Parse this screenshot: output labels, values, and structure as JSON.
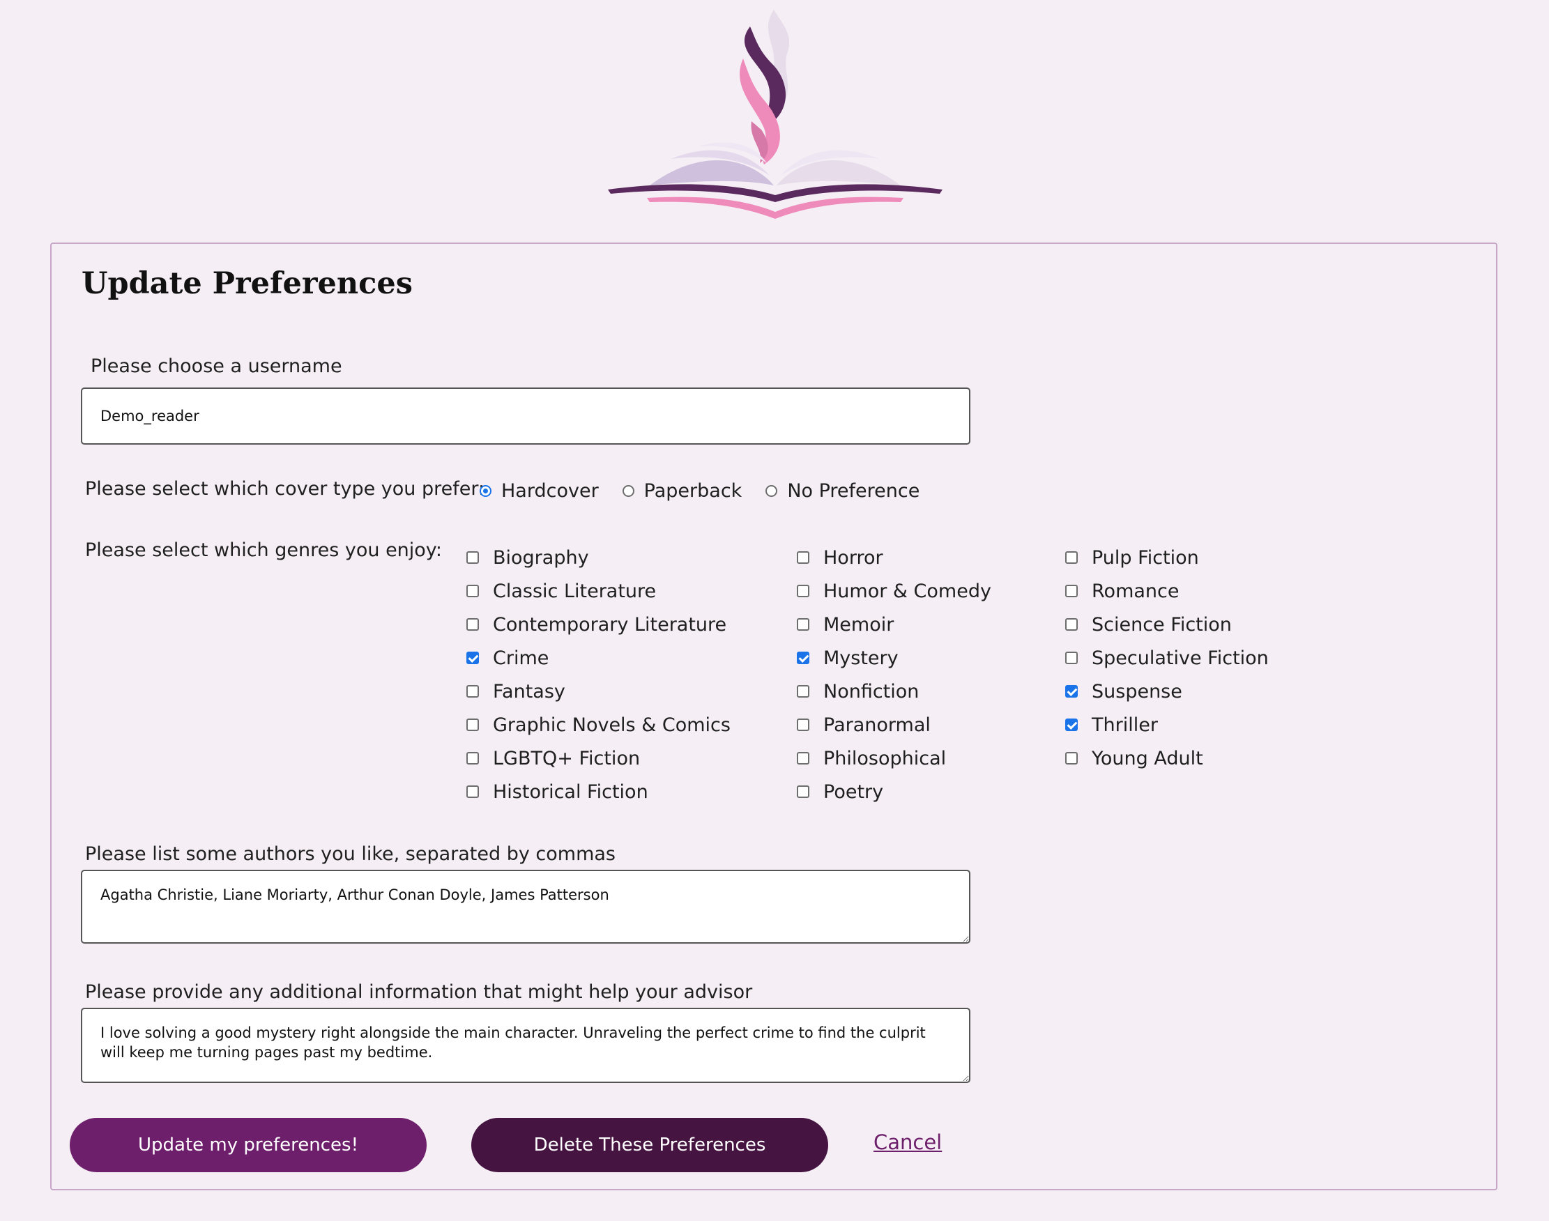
{
  "logo": {
    "name": "book-flame-logo",
    "colors": {
      "dark_purple": "#5a2a5e",
      "pink": "#ef8bbb",
      "lavender": "#d7c6e2",
      "light_lavender": "#e6dcea"
    }
  },
  "form": {
    "title": "Update Preferences",
    "username": {
      "label": "Please choose a username",
      "value": "Demo_reader"
    },
    "cover_type": {
      "label": "Please select which cover type you prefer:",
      "options": [
        {
          "label": "Hardcover",
          "selected": true
        },
        {
          "label": "Paperback",
          "selected": false
        },
        {
          "label": "No Preference",
          "selected": false
        }
      ]
    },
    "genres": {
      "label": "Please select which genres you enjoy:",
      "columns": [
        [
          {
            "label": "Biography",
            "checked": false
          },
          {
            "label": "Classic Literature",
            "checked": false
          },
          {
            "label": "Contemporary Literature",
            "checked": false
          },
          {
            "label": "Crime",
            "checked": true
          },
          {
            "label": "Fantasy",
            "checked": false
          },
          {
            "label": "Graphic Novels & Comics",
            "checked": false
          },
          {
            "label": "LGBTQ+ Fiction",
            "checked": false
          },
          {
            "label": "Historical Fiction",
            "checked": false
          }
        ],
        [
          {
            "label": "Horror",
            "checked": false
          },
          {
            "label": "Humor & Comedy",
            "checked": false
          },
          {
            "label": "Memoir",
            "checked": false
          },
          {
            "label": "Mystery",
            "checked": true
          },
          {
            "label": "Nonfiction",
            "checked": false
          },
          {
            "label": "Paranormal",
            "checked": false
          },
          {
            "label": "Philosophical",
            "checked": false
          },
          {
            "label": "Poetry",
            "checked": false
          }
        ],
        [
          {
            "label": "Pulp Fiction",
            "checked": false
          },
          {
            "label": "Romance",
            "checked": false
          },
          {
            "label": "Science Fiction",
            "checked": false
          },
          {
            "label": "Speculative Fiction",
            "checked": false
          },
          {
            "label": "Suspense",
            "checked": true
          },
          {
            "label": "Thriller",
            "checked": true
          },
          {
            "label": "Young Adult",
            "checked": false
          }
        ]
      ]
    },
    "authors": {
      "label": "Please list some authors you like, separated by commas",
      "value": "Agatha Christie, Liane Moriarty, Arthur Conan Doyle, James Patterson"
    },
    "additional_info": {
      "label": "Please provide any additional information that might help your advisor",
      "value": "I love solving a good mystery right alongside the main character. Unraveling the perfect crime to find the culprit will keep me turning pages past my bedtime."
    },
    "buttons": {
      "update": "Update my preferences!",
      "delete": "Delete These Preferences",
      "cancel": "Cancel"
    }
  },
  "colors": {
    "background": "#f5eff5",
    "card_border": "#c7a6c7",
    "primary_button": "#6e1f6b",
    "danger_button": "#451441",
    "link": "#6e1f6b",
    "control_accent": "#1a73e8"
  }
}
